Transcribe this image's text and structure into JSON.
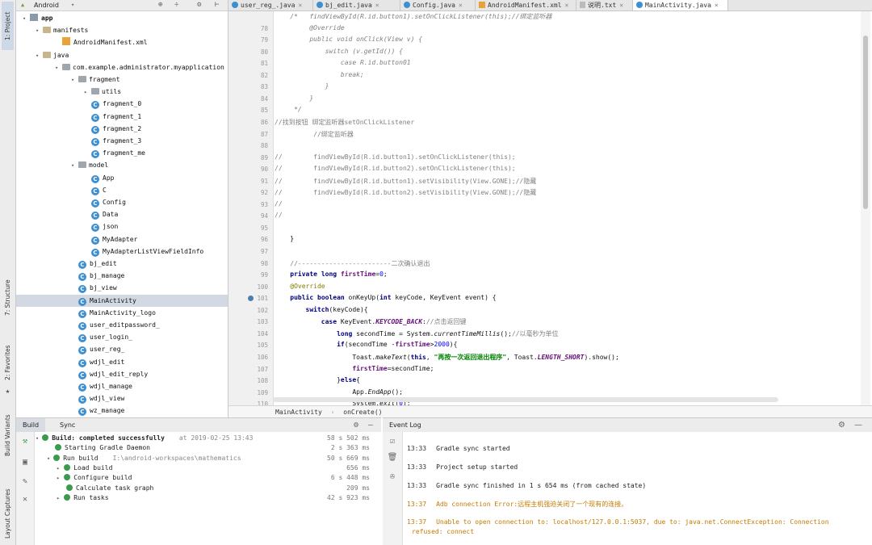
{
  "left_strip": {
    "tabs": [
      "1: Project",
      "7: Structure",
      "2: Favorites",
      "Build Variants",
      "Layout Captures"
    ]
  },
  "project_panel": {
    "view_selector": "Android",
    "tree": [
      {
        "label": "app",
        "depth": 0,
        "icon": "app-folder-icon",
        "expanded": true
      },
      {
        "label": "manifests",
        "depth": 1,
        "icon": "folder-icon",
        "expanded": true
      },
      {
        "label": "AndroidManifest.xml",
        "depth": 2,
        "icon": "xml-file-icon"
      },
      {
        "label": "java",
        "depth": 1,
        "icon": "folder-icon",
        "expanded": true
      },
      {
        "label": "com.example.administrator.myapplication",
        "depth": 2,
        "icon": "package-icon",
        "expanded": true
      },
      {
        "label": "fragment",
        "depth": 3,
        "icon": "package-icon",
        "expanded": true
      },
      {
        "label": "utils",
        "depth": 4,
        "icon": "package-icon",
        "expanded": false
      },
      {
        "label": "fragment_0",
        "depth": 4,
        "icon": "class-icon"
      },
      {
        "label": "fragment_1",
        "depth": 4,
        "icon": "class-icon"
      },
      {
        "label": "fragment_2",
        "depth": 4,
        "icon": "class-icon"
      },
      {
        "label": "fragment_3",
        "depth": 4,
        "icon": "class-icon"
      },
      {
        "label": "fragment_me",
        "depth": 4,
        "icon": "class-icon"
      },
      {
        "label": "model",
        "depth": 3,
        "icon": "package-icon",
        "expanded": true
      },
      {
        "label": "App",
        "depth": 4,
        "icon": "class-icon"
      },
      {
        "label": "C",
        "depth": 4,
        "icon": "class-icon"
      },
      {
        "label": "Config",
        "depth": 4,
        "icon": "class-icon"
      },
      {
        "label": "Data",
        "depth": 4,
        "icon": "class-icon"
      },
      {
        "label": "json",
        "depth": 4,
        "icon": "class-icon"
      },
      {
        "label": "MyAdapter",
        "depth": 4,
        "icon": "class-icon"
      },
      {
        "label": "MyAdapterListViewFieldInfo",
        "depth": 4,
        "icon": "class-icon"
      },
      {
        "label": "bj_edit",
        "depth": 3,
        "icon": "class-icon"
      },
      {
        "label": "bj_manage",
        "depth": 3,
        "icon": "class-icon"
      },
      {
        "label": "bj_view",
        "depth": 3,
        "icon": "class-icon"
      },
      {
        "label": "MainActivity",
        "depth": 3,
        "icon": "class-icon",
        "selected": true
      },
      {
        "label": "MainActivity_logo",
        "depth": 3,
        "icon": "class-icon"
      },
      {
        "label": "user_editpassword_",
        "depth": 3,
        "icon": "class-icon"
      },
      {
        "label": "user_login_",
        "depth": 3,
        "icon": "class-icon"
      },
      {
        "label": "user_reg_",
        "depth": 3,
        "icon": "class-icon"
      },
      {
        "label": "wdjl_edit",
        "depth": 3,
        "icon": "class-icon"
      },
      {
        "label": "wdjl_edit_reply",
        "depth": 3,
        "icon": "class-icon"
      },
      {
        "label": "wdjl_manage",
        "depth": 3,
        "icon": "class-icon"
      },
      {
        "label": "wdjl_view",
        "depth": 3,
        "icon": "class-icon"
      },
      {
        "label": "wz_manage",
        "depth": 3,
        "icon": "class-icon"
      }
    ]
  },
  "editor_tabs": [
    {
      "label": "user_reg_.java",
      "icon": "class-icon"
    },
    {
      "label": "bj_edit.java",
      "icon": "class-icon"
    },
    {
      "label": "Config.java",
      "icon": "class-icon"
    },
    {
      "label": "AndroidManifest.xml",
      "icon": "xml-file-icon"
    },
    {
      "label": "说明.txt",
      "icon": "text-file-icon"
    },
    {
      "label": "MainActivity.java",
      "icon": "class-icon",
      "active": true
    }
  ],
  "code_lines": [
    {
      "n": "",
      "t": "    /*   findViewById(R.id.button1).setOnClickListener(this);//绑定监听器"
    },
    {
      "n": "78",
      "t": "         @Override"
    },
    {
      "n": "79",
      "t": "         public void onClick(View v) {"
    },
    {
      "n": "80",
      "t": "             switch (v.getId()) {"
    },
    {
      "n": "81",
      "t": "                 case R.id.button01"
    },
    {
      "n": "82",
      "t": "                 break;"
    },
    {
      "n": "83",
      "t": "             }"
    },
    {
      "n": "84",
      "t": "         }"
    },
    {
      "n": "85",
      "t": "     */"
    },
    {
      "n": "86",
      "t": "//找到按钮 绑定监听器setOnClickListener"
    },
    {
      "n": "87",
      "t": "          //绑定监听器"
    },
    {
      "n": "88",
      "t": ""
    },
    {
      "n": "89",
      "t": "//        findViewById(R.id.button1).setOnClickListener(this);"
    },
    {
      "n": "90",
      "t": "//        findViewById(R.id.button2).setOnClickListener(this);"
    },
    {
      "n": "91",
      "t": "//        findViewById(R.id.button1).setVisibility(View.GONE);//隐藏"
    },
    {
      "n": "92",
      "t": "//        findViewById(R.id.button2).setVisibility(View.GONE);//隐藏"
    },
    {
      "n": "93",
      "t": "//"
    },
    {
      "n": "94",
      "t": "//"
    },
    {
      "n": "95",
      "t": ""
    },
    {
      "n": "96",
      "t": "    }"
    },
    {
      "n": "97",
      "t": ""
    },
    {
      "n": "98",
      "t": "    //------------------------二次确认退出"
    },
    {
      "n": "99",
      "t": "    private long firstTime=0;"
    },
    {
      "n": "100",
      "t": "    @Override"
    },
    {
      "n": "101",
      "t": "    public boolean onKeyUp(int keyCode, KeyEvent event) {"
    },
    {
      "n": "102",
      "t": "        switch(keyCode){"
    },
    {
      "n": "103",
      "t": "            case KeyEvent.KEYCODE_BACK://点击返回键"
    },
    {
      "n": "104",
      "t": "                long secondTime = System.currentTimeMillis();//以毫秒为单位"
    },
    {
      "n": "105",
      "t": "                if(secondTime -firstTime>2000){"
    },
    {
      "n": "106",
      "t": "                    Toast.makeText(this, \"再按一次返回退出程序\", Toast.LENGTH_SHORT).show();"
    },
    {
      "n": "107",
      "t": "                    firstTime=secondTime;"
    },
    {
      "n": "108",
      "t": "                }else{"
    },
    {
      "n": "109",
      "t": "                    App.EndApp();"
    },
    {
      "n": "110",
      "t": "                    System.exit(0);"
    }
  ],
  "breadcrumb": {
    "class": "MainActivity",
    "method": "onCreate()"
  },
  "build_panel": {
    "tabs": [
      "Build",
      "Sync"
    ],
    "rows": [
      {
        "text": "Build: completed successfully",
        "extra": "at 2019-02-25 13:43",
        "time": "58 s 502 ms",
        "depth": 0
      },
      {
        "text": "Starting Gradle Daemon",
        "time": "2 s 363 ms",
        "depth": 1
      },
      {
        "text": "Run build",
        "extra": "I:\\android-workspaces\\mathematics",
        "time": "50 s 669 ms",
        "depth": 1
      },
      {
        "text": "Load build",
        "time": "656 ms",
        "depth": 2
      },
      {
        "text": "Configure build",
        "time": "6 s 448 ms",
        "depth": 2
      },
      {
        "text": "Calculate task graph",
        "time": "209 ms",
        "depth": 2
      },
      {
        "text": "Run tasks",
        "time": "42 s 923 ms",
        "depth": 2
      }
    ]
  },
  "event_log": {
    "title": "Event Log",
    "entries": [
      {
        "time": "13:33",
        "msg": "Gradle sync started",
        "warn": false
      },
      {
        "time": "13:33",
        "msg": "Project setup started",
        "warn": false
      },
      {
        "time": "13:33",
        "msg": "Gradle sync finished in 1 s 654 ms (from cached state)",
        "warn": false
      },
      {
        "time": "13:37",
        "msg": "Adb connection Error:远程主机强迫关闭了一个现有的连接。",
        "warn": true
      },
      {
        "time": "13:37",
        "msg": "Unable to open connection to: localhost/127.0.0.1:5037, due to: java.net.ConnectException: Connection",
        "msg2": "refused: connect",
        "warn": true
      }
    ]
  }
}
